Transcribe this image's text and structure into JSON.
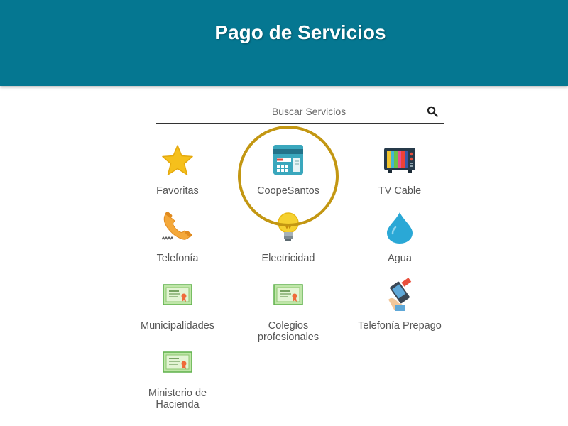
{
  "header": {
    "title": "Pago de Servicios",
    "color": "#057791"
  },
  "search": {
    "placeholder": "Buscar Servicios",
    "icon": "search-icon"
  },
  "highlight_color": "#c39712",
  "services": [
    {
      "id": "favoritas",
      "label": "Favoritas",
      "icon": "star-icon"
    },
    {
      "id": "coopesantos",
      "label": "CoopeSantos",
      "icon": "payment-terminal-icon",
      "highlighted": true
    },
    {
      "id": "tv-cable",
      "label": "TV Cable",
      "icon": "tv-icon"
    },
    {
      "id": "telefonia",
      "label": "Telefonía",
      "icon": "phone-icon"
    },
    {
      "id": "electricidad",
      "label": "Electricidad",
      "icon": "lightbulb-icon"
    },
    {
      "id": "agua",
      "label": "Agua",
      "icon": "water-drop-icon"
    },
    {
      "id": "municipalidades",
      "label": "Municipalidades",
      "icon": "certificate-icon"
    },
    {
      "id": "colegios-profesionales",
      "label_lines": [
        "Colegios",
        "profesionales"
      ],
      "icon": "certificate-icon"
    },
    {
      "id": "telefonia-prepago",
      "label": "Telefonía Prepago",
      "icon": "prepaid-phone-icon"
    },
    {
      "id": "ministerio-de-hacienda",
      "label_lines": [
        "Ministerio de",
        "Hacienda"
      ],
      "icon": "certificate-icon"
    }
  ]
}
